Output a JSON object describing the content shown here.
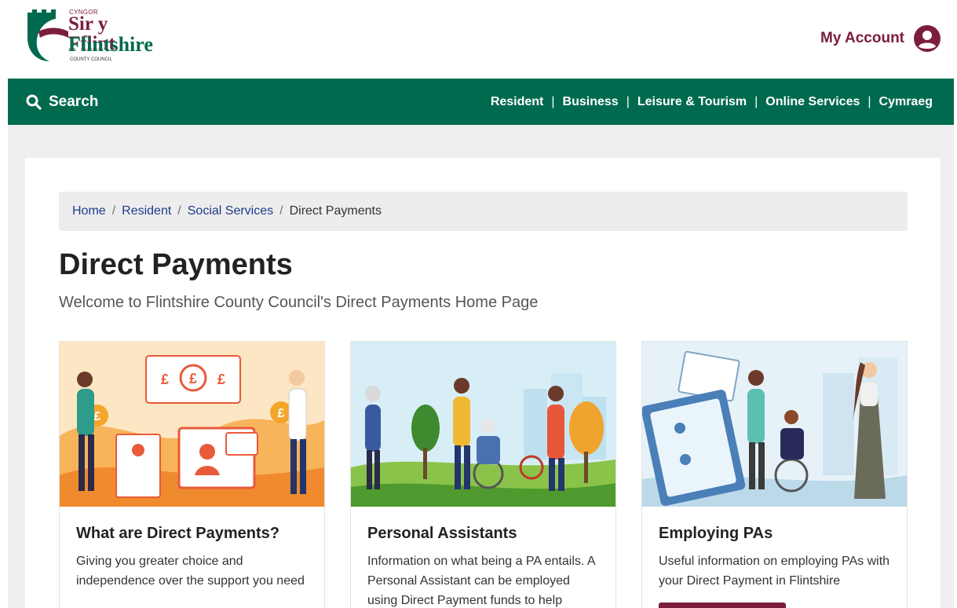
{
  "header": {
    "logo": {
      "small": "CYNGOR",
      "line1": "Sir y Fflint",
      "line2": "Flintshire",
      "sub": "COUNTY COUNCIL"
    },
    "account_label": "My Account"
  },
  "nav": {
    "search_label": "Search",
    "links": [
      "Resident",
      "Business",
      "Leisure & Tourism",
      "Online Services",
      "Cymraeg"
    ]
  },
  "breadcrumb": {
    "items": [
      "Home",
      "Resident",
      "Social Services"
    ],
    "current": "Direct Payments"
  },
  "page": {
    "title": "Direct Payments",
    "subtitle": "Welcome to Flintshire County Council's Direct Payments Home Page"
  },
  "cards": [
    {
      "title": "What are Direct Payments?",
      "text": "Giving you greater choice and independence over the support you need"
    },
    {
      "title": "Personal Assistants",
      "text": "Information on what being a PA entails. A Personal Assistant can be employed using Direct Payment funds to help"
    },
    {
      "title": "Employing PAs",
      "text": "Useful information on employing PAs with your Direct Payment in Flintshire"
    }
  ],
  "colors": {
    "brand_green": "#006a4e",
    "brand_maroon": "#7b1d3f",
    "link_blue": "#1f3b8c"
  }
}
